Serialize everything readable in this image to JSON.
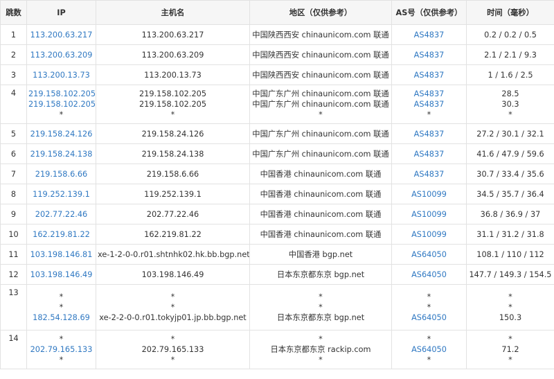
{
  "columns": [
    "跳数",
    "IP",
    "主机名",
    "地区（仅供参考）",
    "AS号（仅供参考）",
    "时间（毫秒）"
  ],
  "rows": [
    {
      "hop": "1",
      "ip": [
        "113.200.63.217"
      ],
      "host": [
        "113.200.63.217"
      ],
      "region": [
        "中国陕西西安 chinaunicom.com 联通"
      ],
      "asn": [
        "AS4837"
      ],
      "time": [
        "0.2 / 0.2 / 0.5"
      ]
    },
    {
      "hop": "2",
      "ip": [
        "113.200.63.209"
      ],
      "host": [
        "113.200.63.209"
      ],
      "region": [
        "中国陕西西安 chinaunicom.com 联通"
      ],
      "asn": [
        "AS4837"
      ],
      "time": [
        "2.1 / 2.1 / 9.3"
      ]
    },
    {
      "hop": "3",
      "ip": [
        "113.200.13.73"
      ],
      "host": [
        "113.200.13.73"
      ],
      "region": [
        "中国陕西西安 chinaunicom.com 联通"
      ],
      "asn": [
        "AS4837"
      ],
      "time": [
        "1 / 1.6 / 2.5"
      ]
    },
    {
      "hop": "4",
      "ip": [
        "219.158.102.205",
        "219.158.102.205",
        "*"
      ],
      "host": [
        "219.158.102.205",
        "219.158.102.205",
        "*"
      ],
      "region": [
        "中国广东广州 chinaunicom.com 联通",
        "中国广东广州 chinaunicom.com 联通",
        "*"
      ],
      "asn": [
        "AS4837",
        "AS4837",
        "*"
      ],
      "time": [
        "28.5",
        "30.3",
        "*"
      ]
    },
    {
      "hop": "5",
      "ip": [
        "219.158.24.126"
      ],
      "host": [
        "219.158.24.126"
      ],
      "region": [
        "中国广东广州 chinaunicom.com 联通"
      ],
      "asn": [
        "AS4837"
      ],
      "time": [
        "27.2 / 30.1 / 32.1"
      ]
    },
    {
      "hop": "6",
      "ip": [
        "219.158.24.138"
      ],
      "host": [
        "219.158.24.138"
      ],
      "region": [
        "中国广东广州 chinaunicom.com 联通"
      ],
      "asn": [
        "AS4837"
      ],
      "time": [
        "41.6 / 47.9 / 59.6"
      ]
    },
    {
      "hop": "7",
      "ip": [
        "219.158.6.66"
      ],
      "host": [
        "219.158.6.66"
      ],
      "region": [
        "中国香港 chinaunicom.com 联通"
      ],
      "asn": [
        "AS4837"
      ],
      "time": [
        "30.7 / 33.4 / 35.6"
      ]
    },
    {
      "hop": "8",
      "ip": [
        "119.252.139.1"
      ],
      "host": [
        "119.252.139.1"
      ],
      "region": [
        "中国香港 chinaunicom.com 联通"
      ],
      "asn": [
        "AS10099"
      ],
      "time": [
        "34.5 / 35.7 / 36.4"
      ]
    },
    {
      "hop": "9",
      "ip": [
        "202.77.22.46"
      ],
      "host": [
        "202.77.22.46"
      ],
      "region": [
        "中国香港 chinaunicom.com 联通"
      ],
      "asn": [
        "AS10099"
      ],
      "time": [
        "36.8 / 36.9 / 37"
      ]
    },
    {
      "hop": "10",
      "ip": [
        "162.219.81.22"
      ],
      "host": [
        "162.219.81.22"
      ],
      "region": [
        "中国香港 chinaunicom.com 联通"
      ],
      "asn": [
        "AS10099"
      ],
      "time": [
        "31.1 / 31.2 / 31.8"
      ]
    },
    {
      "hop": "11",
      "ip": [
        "103.198.146.81"
      ],
      "host": [
        "xe-1-2-0-0.r01.shtnhk02.hk.bb.bgp.net"
      ],
      "region": [
        "中国香港 bgp.net"
      ],
      "asn": [
        "AS64050"
      ],
      "time": [
        "108.1 / 110 / 112"
      ]
    },
    {
      "hop": "12",
      "ip": [
        "103.198.146.49"
      ],
      "host": [
        "103.198.146.49"
      ],
      "region": [
        "日本东京都东京 bgp.net"
      ],
      "asn": [
        "AS64050"
      ],
      "time": [
        "147.7 / 149.3 / 154.5"
      ]
    },
    {
      "hop": "13",
      "ip": [
        "*",
        "*",
        "182.54.128.69"
      ],
      "host": [
        "*",
        "*",
        "xe-2-2-0-0.r01.tokyjp01.jp.bb.bgp.net"
      ],
      "region": [
        "*",
        "*",
        "日本东京都东京 bgp.net"
      ],
      "asn": [
        "*",
        "*",
        "AS64050"
      ],
      "time": [
        "*",
        "*",
        "150.3"
      ]
    },
    {
      "hop": "14",
      "ip": [
        "*",
        "202.79.165.133",
        "*"
      ],
      "host": [
        "*",
        "202.79.165.133",
        "*"
      ],
      "region": [
        "*",
        "日本东京都东京 rackip.com",
        "*"
      ],
      "asn": [
        "*",
        "AS64050",
        "*"
      ],
      "time": [
        "*",
        "71.2",
        "*"
      ]
    }
  ],
  "colors": {
    "link": "#2f78c2",
    "header_bg": "#f6f6f6",
    "border": "#e2e2e2",
    "text": "#333333"
  }
}
